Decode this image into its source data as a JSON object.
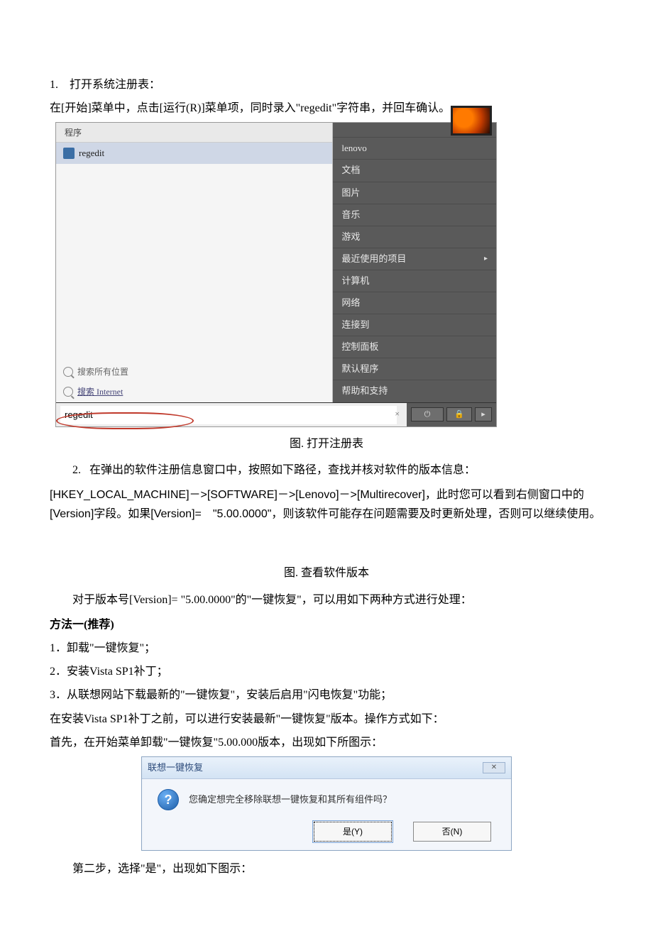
{
  "doc": {
    "step1_num": "1.",
    "step1_title": "打开系统注册表：",
    "step1_desc": "在[开始]菜单中，点击[运行(R)]菜单项，同时录入\"regedit\"字符串，并回车确认。",
    "caption1": "图. 打开注册表",
    "step2_num": "2.",
    "step2_desc": "在弹出的软件注册信息窗口中，按照如下路径，查找并核对软件的版本信息：",
    "reg_path": "[HKEY_LOCAL_MACHINE]－>[SOFTWARE]－>[Lenovo]－>[Multirecover]，此时您可以看到右侧窗口中的[Version]字段。如果[Version]=　\"5.00.0000\"，则该软件可能存在问题需要及时更新处理，否则可以继续使用。",
    "caption2": "图. 查看软件版本",
    "version_note": "对于版本号[Version]= \"5.00.0000\"的\"一键恢复\"，可以用如下两种方式进行处理：",
    "method1_title": "方法一(推荐)",
    "m1_1": "1．卸载\"一键恢复\"；",
    "m1_2": "2．安装Vista SP1补丁；",
    "m1_3": "3．从联想网站下载最新的\"一键恢复\"，安装后启用\"闪电恢复\"功能；",
    "m1_note1": "在安装Vista SP1补丁之前，可以进行安装最新\"一键恢复\"版本。操作方式如下：",
    "m1_note2": "首先，在开始菜单卸载\"一键恢复\"5.00.000版本，出现如下所图示：",
    "step2_after_dlg": "第二步，选择\"是\"，出现如下图示："
  },
  "startmenu": {
    "programs_header": "程序",
    "program_item": "regedit",
    "search_all": "搜索所有位置",
    "search_internet": "搜索 Internet",
    "input_value": "regedit",
    "clear": "×",
    "right_items": [
      "lenovo",
      "文档",
      "图片",
      "音乐",
      "游戏",
      "最近使用的项目",
      "计算机",
      "网络",
      "连接到",
      "控制面板",
      "默认程序",
      "帮助和支持"
    ],
    "recent_arrow": "▸",
    "power_icon": "⏻",
    "lock_icon": "🔒",
    "menu_icon": "▸"
  },
  "dialog": {
    "title": "联想一键恢复",
    "close": "✕",
    "icon_glyph": "?",
    "message": "您确定想完全移除联想一键恢复和其所有组件吗？",
    "yes": "是(Y)",
    "no": "否(N)"
  }
}
